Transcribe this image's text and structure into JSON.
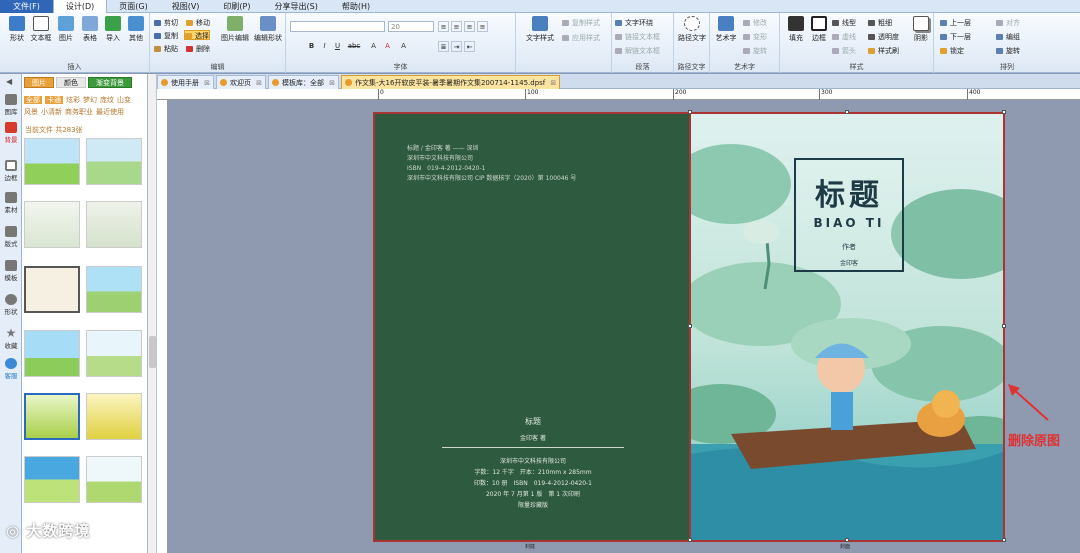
{
  "menu": {
    "items": [
      "文件(F)",
      "设计(D)",
      "页面(G)",
      "视图(V)",
      "印刷(P)",
      "分享导出(S)",
      "帮助(H)"
    ]
  },
  "ribbon": {
    "insert": {
      "label": "插入",
      "buttons": [
        "形状",
        "文本框",
        "图片",
        "表格",
        "导入",
        "其他"
      ]
    },
    "edit": {
      "label": "编辑",
      "cut": "剪切",
      "copy": "复制",
      "paste": "粘贴",
      "move": "移动",
      "select": "选择",
      "delete": "删除",
      "image_edit": "图片编辑",
      "shape_edit": "编辑形状"
    },
    "font": {
      "label": "字体",
      "size": "20",
      "buttons": [
        "B",
        "I",
        "U",
        "abc",
        "A",
        "A",
        "A"
      ]
    },
    "paragraph": {
      "label": "段落",
      "text_style": "文字样式",
      "copy_style": "复制样式",
      "apply_style": "应用样式",
      "text_wrap": "文字环绕",
      "link_box": "链接文本框",
      "unlink_box": "解链文本框"
    },
    "path_text": {
      "label": "路径文字",
      "button": "路径文字"
    },
    "art_text": {
      "label": "艺术字",
      "button": "艺术字",
      "modify": "修改",
      "transform": "变形",
      "rotate": "旋转"
    },
    "style": {
      "label": "样式",
      "fill": "填充",
      "border": "边框",
      "line_type": "线型",
      "thickness": "粗细",
      "dash": "虚线",
      "transparency": "透明度",
      "arrow": "箭头",
      "style_brush": "样式刷",
      "shadow": "阴影"
    },
    "arrange": {
      "label": "排列",
      "up": "上一层",
      "down": "下一层",
      "lock": "锁定",
      "align": "对齐",
      "group": "编组",
      "rotate": "旋转"
    }
  },
  "leftbar": {
    "items": [
      "图库",
      "背景",
      "边框",
      "素材",
      "版式",
      "模板",
      "形状",
      "收藏",
      "客服"
    ]
  },
  "panel": {
    "tabs": [
      "图片",
      "颜色",
      "渐变背景"
    ],
    "categories": [
      "全部",
      "卡通",
      "炫彩",
      "梦幻",
      "庞纹",
      "山变",
      "风景",
      "小清新",
      "商务职业",
      "最近使用"
    ],
    "count": "当前文件 共283张"
  },
  "doc_tabs": [
    "使用手册",
    "欢迎页",
    "模板库：全部",
    "作文集-大16开软皮平装-暑季暑期作文集200714-1145.dpsf"
  ],
  "ruler": {
    "labels": [
      "0",
      "100",
      "200",
      "300",
      "400"
    ]
  },
  "back_cover": {
    "info": [
      "标题 / 金印客 著 —— 深圳",
      "深圳市中文科技有限公司",
      "ISBN　019-4-2012-0420-1",
      "深圳市中文科技有限公司  CIP 数据核字（2020）第 100046 号"
    ],
    "title": "标题",
    "author": "金印客 著",
    "publisher": "深圳市中文科技有限公司",
    "specs": [
      "字数：12 千字　开本：210mm x 285mm",
      "印数：10 册　ISBN　019-4-2012-0420-1",
      "2020 年 7 月第 1 版　第 1 次印刷",
      "限量珍藏版"
    ],
    "label": "封底"
  },
  "front_cover": {
    "title_cn": "标题",
    "title_en": "BIAO TI",
    "author_label": "作者",
    "author_name": "金印客",
    "label": "封面"
  },
  "annotation": "删除原图",
  "watermark": "大数跨境",
  "colors": {
    "accent": "#e8a13a",
    "cover_green": "#2e5a40",
    "annotation": "#e03232"
  }
}
